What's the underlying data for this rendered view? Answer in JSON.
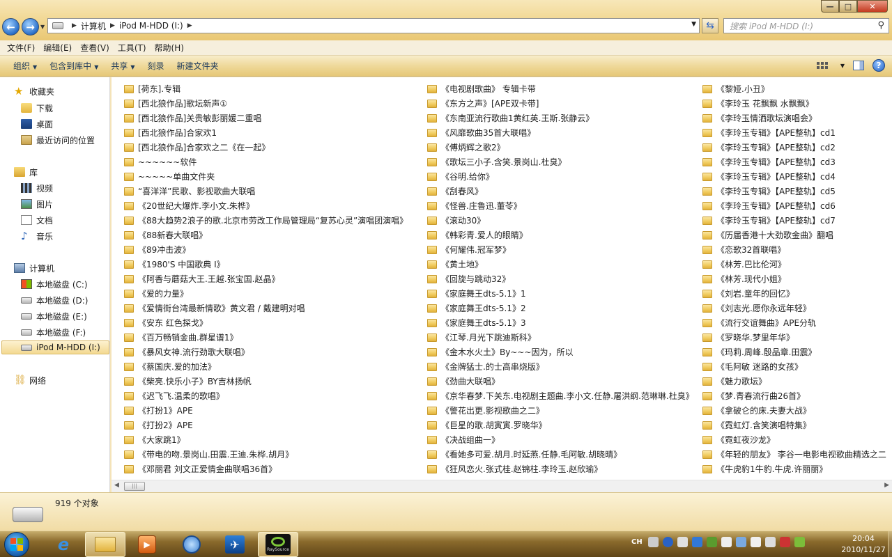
{
  "window": {
    "min_glyph": "—",
    "max_glyph": "□",
    "close_glyph": "✕"
  },
  "address": {
    "segments": [
      "计算机",
      "iPod M-HDD (I:)"
    ],
    "search_placeholder": "搜索 iPod M-HDD (I:)"
  },
  "menu": [
    "文件(F)",
    "编辑(E)",
    "查看(V)",
    "工具(T)",
    "帮助(H)"
  ],
  "toolbar": {
    "organize": "组织",
    "include_library": "包含到库中",
    "share": "共享",
    "burn": "刻录",
    "new_folder": "新建文件夹"
  },
  "nav": {
    "favorites": "收藏夹",
    "downloads": "下载",
    "desktop": "桌面",
    "recent": "最近访问的位置",
    "libraries": "库",
    "videos": "视频",
    "pictures": "图片",
    "documents": "文档",
    "music": "音乐",
    "computer": "计算机",
    "drive_c": "本地磁盘 (C:)",
    "drive_d": "本地磁盘 (D:)",
    "drive_e": "本地磁盘 (E:)",
    "drive_f": "本地磁盘 (F:)",
    "drive_i": "iPod M-HDD (I:)",
    "network": "网络"
  },
  "files": {
    "col1": [
      "[荷东].专辑",
      "[西北狼作品]歌坛新声①",
      "[西北狼作品]关贵敏彭丽媛二重唱",
      "[西北狼作品]合家欢1",
      "[西北狼作品]合家欢之二《在一起》",
      "~~~~~~软件",
      "~~~~~单曲文件夹",
      "“喜洋洋”民歌、影视歌曲大联唱",
      "《20世纪大爆炸.李小文.朱桦》",
      "《88大趋势2浪子的歌.北京市劳改工作局管理局“复苏心灵”演唱团演唱》",
      "《88新春大联唱》",
      "《89冲击波》",
      "《1980'S 中国歌典 I》",
      "《阿香与蘑菇大王.王越.张宝国.赵晶》",
      "《爱的力量》",
      "《爱情街台湾最新情歌》黄文君 / 戴建明对唱",
      "《安东 红色探戈》",
      "《百万畅销金曲.群星谱1》",
      "《暴风女神.流行劲歌大联唱》",
      "《蔡国庆.爱的加法》",
      "《柴亮.快乐小子》BY吉林扬帆",
      "《迟飞飞.温柔的歌唱》",
      "《打扮1》APE",
      "《打扮2》APE",
      "《大家跳1》",
      "《带电的吻.景岗山.田震.王迪.朱桦.胡月》",
      "《邓丽君 刘文正爱情金曲联唱36首》"
    ],
    "col2": [
      "《电视剧歌曲》    专辑卡带",
      "《东方之声》[APE双卡带]",
      "《东南亚流行歌曲1黄红英.王斯.张静云》",
      "《风靡歌曲35首大联唱》",
      "《傅炳辉之歌2》",
      "《歌坛三小子.含笑.景岗山.杜臭》",
      "《谷明.给你》",
      "《刮春风》",
      "《怪兽.庄鲁迅.董苓》",
      "《滚动30》",
      "《韩彩青.爱人的眼睛》",
      "《何耀伟.冠军梦》",
      "《黄土地》",
      "《回旋与跳动32》",
      "《家庭舞王dts-5.1》1",
      "《家庭舞王dts-5.1》2",
      "《家庭舞王dts-5.1》3",
      "《江琴.月光下跳迪斯科》",
      "《金木水火土》By~~~因为，所以",
      "《金牌猛士.的士高串烧版》",
      "《劲曲大联唱》",
      "《京华春梦.下关东.电视剧主题曲.李小文.任静.屠洪纲.范琳琳.杜臭》",
      "《警花出更.影视歌曲之二》",
      "《巨星的歌.胡寅寅.罗晓华》",
      "《决战组曲一》",
      "《看她多可爱.胡月.时延燕.任静.毛阿敏.胡晓晴》",
      "《狂风恋火.张式桂.赵锦柱.李玲玉.赵欣瑜》"
    ],
    "col3": [
      "《黎娅.小丑》",
      "《李玲玉 花飘飘 水飘飘》",
      "《李玲玉情洒歌坛演唱会》",
      "《李玲玉专辑》【APE整轨】cd1",
      "《李玲玉专辑》【APE整轨】cd2",
      "《李玲玉专辑》【APE整轨】cd3",
      "《李玲玉专辑》【APE整轨】cd4",
      "《李玲玉专辑》【APE整轨】cd5",
      "《李玲玉专辑》【APE整轨】cd6",
      "《李玲玉专辑》【APE整轨】cd7",
      "《历届香港十大劲歌金曲》翻唱",
      "《恋歌32首联唱》",
      "《林芳.巴比伦河》",
      "《林芳.现代小姐》",
      "《刘岩.童年的回忆》",
      "《刘志光.愿你永远年轻》",
      "《流行交谊舞曲》APE分轨",
      "《罗晓华.梦里年华》",
      "《玛莉.周峰.殷品章.田震》",
      "《毛阿敏 迷路的女孩》",
      "《魅力歌坛》",
      "《梦.青春流行曲26首》",
      "《拿破仑的床.夫妻大战》",
      "《霓虹灯.含笑演唱特集》",
      "《霓虹夜沙龙》",
      "《年轻的朋友》   李谷一电影电视歌曲精选之二",
      "《牛虎豹1牛豹.牛虎.许丽丽》"
    ]
  },
  "status": {
    "count": "919 个对象"
  },
  "taskbar": {
    "ray_label": "RaySource",
    "ime": "CH",
    "time": "20:04",
    "date": "2010/11/27"
  }
}
